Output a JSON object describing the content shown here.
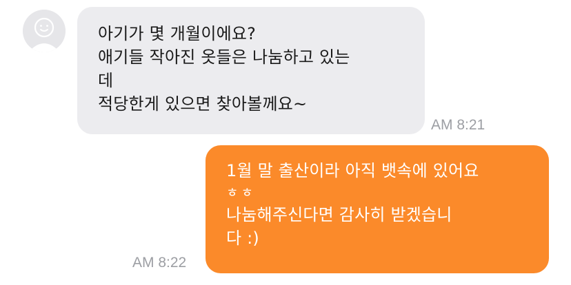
{
  "messages": [
    {
      "sender": "other",
      "avatar_icon": "default-profile-icon",
      "lines": [
        "아기가 몇 개월이에요?",
        "애기들 작아진 옷들은 나눔하고 있는",
        "데",
        "적당한게 있으면 찾아볼께요~"
      ],
      "time": "AM 8:21"
    },
    {
      "sender": "me",
      "lines": [
        "1월 말 출산이라 아직 뱃속에 있어요",
        "ㅎㅎ",
        "나눔해주신다면 감사히 받겠습니",
        "다 :)"
      ],
      "time": "AM 8:22"
    }
  ],
  "colors": {
    "incoming_bubble": "#ececef",
    "outgoing_bubble": "#fb8a2a",
    "timestamp": "#9c9ea3"
  }
}
